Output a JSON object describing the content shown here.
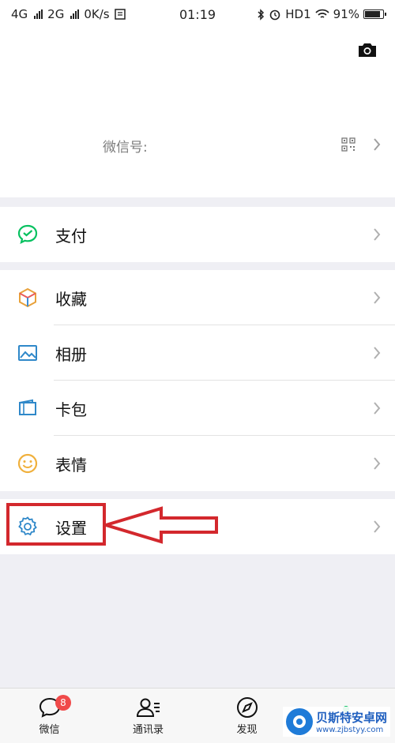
{
  "status_bar": {
    "network1": "4G",
    "network2": "2G",
    "speed": "0K/s",
    "time": "01:19",
    "hd": "HD1",
    "battery": "91%"
  },
  "profile": {
    "wechat_id_label": "微信号:"
  },
  "menu": {
    "pay": "支付",
    "favorites": "收藏",
    "album": "相册",
    "cards": "卡包",
    "stickers": "表情",
    "settings": "设置"
  },
  "tabbar": {
    "chats": "微信",
    "chats_badge": "8",
    "contacts": "通讯录",
    "discover": "发现"
  },
  "watermark": {
    "title": "贝斯特安卓网",
    "url": "www.zjbstyy.com"
  },
  "colors": {
    "accent_green": "#07c160",
    "highlight_red": "#d3282d",
    "badge_red": "#f04a4a",
    "settings_blue": "#2f88c9"
  }
}
